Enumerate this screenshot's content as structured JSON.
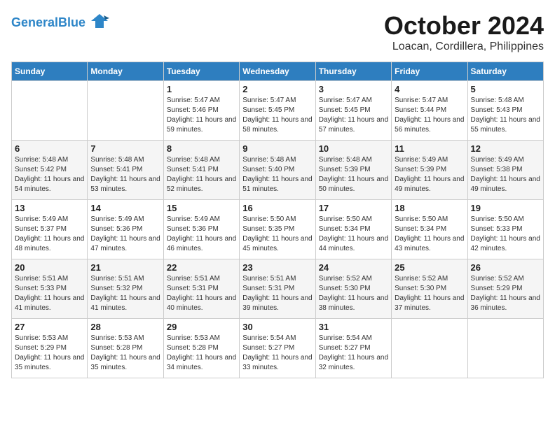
{
  "logo": {
    "line1": "General",
    "line2": "Blue",
    "bird_icon": "🐦"
  },
  "title": "October 2024",
  "location": "Loacan, Cordillera, Philippines",
  "weekdays": [
    "Sunday",
    "Monday",
    "Tuesday",
    "Wednesday",
    "Thursday",
    "Friday",
    "Saturday"
  ],
  "weeks": [
    [
      {
        "day": "",
        "sunrise": "",
        "sunset": "",
        "daylight": ""
      },
      {
        "day": "",
        "sunrise": "",
        "sunset": "",
        "daylight": ""
      },
      {
        "day": "1",
        "sunrise": "Sunrise: 5:47 AM",
        "sunset": "Sunset: 5:46 PM",
        "daylight": "Daylight: 11 hours and 59 minutes."
      },
      {
        "day": "2",
        "sunrise": "Sunrise: 5:47 AM",
        "sunset": "Sunset: 5:45 PM",
        "daylight": "Daylight: 11 hours and 58 minutes."
      },
      {
        "day": "3",
        "sunrise": "Sunrise: 5:47 AM",
        "sunset": "Sunset: 5:45 PM",
        "daylight": "Daylight: 11 hours and 57 minutes."
      },
      {
        "day": "4",
        "sunrise": "Sunrise: 5:47 AM",
        "sunset": "Sunset: 5:44 PM",
        "daylight": "Daylight: 11 hours and 56 minutes."
      },
      {
        "day": "5",
        "sunrise": "Sunrise: 5:48 AM",
        "sunset": "Sunset: 5:43 PM",
        "daylight": "Daylight: 11 hours and 55 minutes."
      }
    ],
    [
      {
        "day": "6",
        "sunrise": "Sunrise: 5:48 AM",
        "sunset": "Sunset: 5:42 PM",
        "daylight": "Daylight: 11 hours and 54 minutes."
      },
      {
        "day": "7",
        "sunrise": "Sunrise: 5:48 AM",
        "sunset": "Sunset: 5:41 PM",
        "daylight": "Daylight: 11 hours and 53 minutes."
      },
      {
        "day": "8",
        "sunrise": "Sunrise: 5:48 AM",
        "sunset": "Sunset: 5:41 PM",
        "daylight": "Daylight: 11 hours and 52 minutes."
      },
      {
        "day": "9",
        "sunrise": "Sunrise: 5:48 AM",
        "sunset": "Sunset: 5:40 PM",
        "daylight": "Daylight: 11 hours and 51 minutes."
      },
      {
        "day": "10",
        "sunrise": "Sunrise: 5:48 AM",
        "sunset": "Sunset: 5:39 PM",
        "daylight": "Daylight: 11 hours and 50 minutes."
      },
      {
        "day": "11",
        "sunrise": "Sunrise: 5:49 AM",
        "sunset": "Sunset: 5:39 PM",
        "daylight": "Daylight: 11 hours and 49 minutes."
      },
      {
        "day": "12",
        "sunrise": "Sunrise: 5:49 AM",
        "sunset": "Sunset: 5:38 PM",
        "daylight": "Daylight: 11 hours and 49 minutes."
      }
    ],
    [
      {
        "day": "13",
        "sunrise": "Sunrise: 5:49 AM",
        "sunset": "Sunset: 5:37 PM",
        "daylight": "Daylight: 11 hours and 48 minutes."
      },
      {
        "day": "14",
        "sunrise": "Sunrise: 5:49 AM",
        "sunset": "Sunset: 5:36 PM",
        "daylight": "Daylight: 11 hours and 47 minutes."
      },
      {
        "day": "15",
        "sunrise": "Sunrise: 5:49 AM",
        "sunset": "Sunset: 5:36 PM",
        "daylight": "Daylight: 11 hours and 46 minutes."
      },
      {
        "day": "16",
        "sunrise": "Sunrise: 5:50 AM",
        "sunset": "Sunset: 5:35 PM",
        "daylight": "Daylight: 11 hours and 45 minutes."
      },
      {
        "day": "17",
        "sunrise": "Sunrise: 5:50 AM",
        "sunset": "Sunset: 5:34 PM",
        "daylight": "Daylight: 11 hours and 44 minutes."
      },
      {
        "day": "18",
        "sunrise": "Sunrise: 5:50 AM",
        "sunset": "Sunset: 5:34 PM",
        "daylight": "Daylight: 11 hours and 43 minutes."
      },
      {
        "day": "19",
        "sunrise": "Sunrise: 5:50 AM",
        "sunset": "Sunset: 5:33 PM",
        "daylight": "Daylight: 11 hours and 42 minutes."
      }
    ],
    [
      {
        "day": "20",
        "sunrise": "Sunrise: 5:51 AM",
        "sunset": "Sunset: 5:33 PM",
        "daylight": "Daylight: 11 hours and 41 minutes."
      },
      {
        "day": "21",
        "sunrise": "Sunrise: 5:51 AM",
        "sunset": "Sunset: 5:32 PM",
        "daylight": "Daylight: 11 hours and 41 minutes."
      },
      {
        "day": "22",
        "sunrise": "Sunrise: 5:51 AM",
        "sunset": "Sunset: 5:31 PM",
        "daylight": "Daylight: 11 hours and 40 minutes."
      },
      {
        "day": "23",
        "sunrise": "Sunrise: 5:51 AM",
        "sunset": "Sunset: 5:31 PM",
        "daylight": "Daylight: 11 hours and 39 minutes."
      },
      {
        "day": "24",
        "sunrise": "Sunrise: 5:52 AM",
        "sunset": "Sunset: 5:30 PM",
        "daylight": "Daylight: 11 hours and 38 minutes."
      },
      {
        "day": "25",
        "sunrise": "Sunrise: 5:52 AM",
        "sunset": "Sunset: 5:30 PM",
        "daylight": "Daylight: 11 hours and 37 minutes."
      },
      {
        "day": "26",
        "sunrise": "Sunrise: 5:52 AM",
        "sunset": "Sunset: 5:29 PM",
        "daylight": "Daylight: 11 hours and 36 minutes."
      }
    ],
    [
      {
        "day": "27",
        "sunrise": "Sunrise: 5:53 AM",
        "sunset": "Sunset: 5:29 PM",
        "daylight": "Daylight: 11 hours and 35 minutes."
      },
      {
        "day": "28",
        "sunrise": "Sunrise: 5:53 AM",
        "sunset": "Sunset: 5:28 PM",
        "daylight": "Daylight: 11 hours and 35 minutes."
      },
      {
        "day": "29",
        "sunrise": "Sunrise: 5:53 AM",
        "sunset": "Sunset: 5:28 PM",
        "daylight": "Daylight: 11 hours and 34 minutes."
      },
      {
        "day": "30",
        "sunrise": "Sunrise: 5:54 AM",
        "sunset": "Sunset: 5:27 PM",
        "daylight": "Daylight: 11 hours and 33 minutes."
      },
      {
        "day": "31",
        "sunrise": "Sunrise: 5:54 AM",
        "sunset": "Sunset: 5:27 PM",
        "daylight": "Daylight: 11 hours and 32 minutes."
      },
      {
        "day": "",
        "sunrise": "",
        "sunset": "",
        "daylight": ""
      },
      {
        "day": "",
        "sunrise": "",
        "sunset": "",
        "daylight": ""
      }
    ]
  ]
}
